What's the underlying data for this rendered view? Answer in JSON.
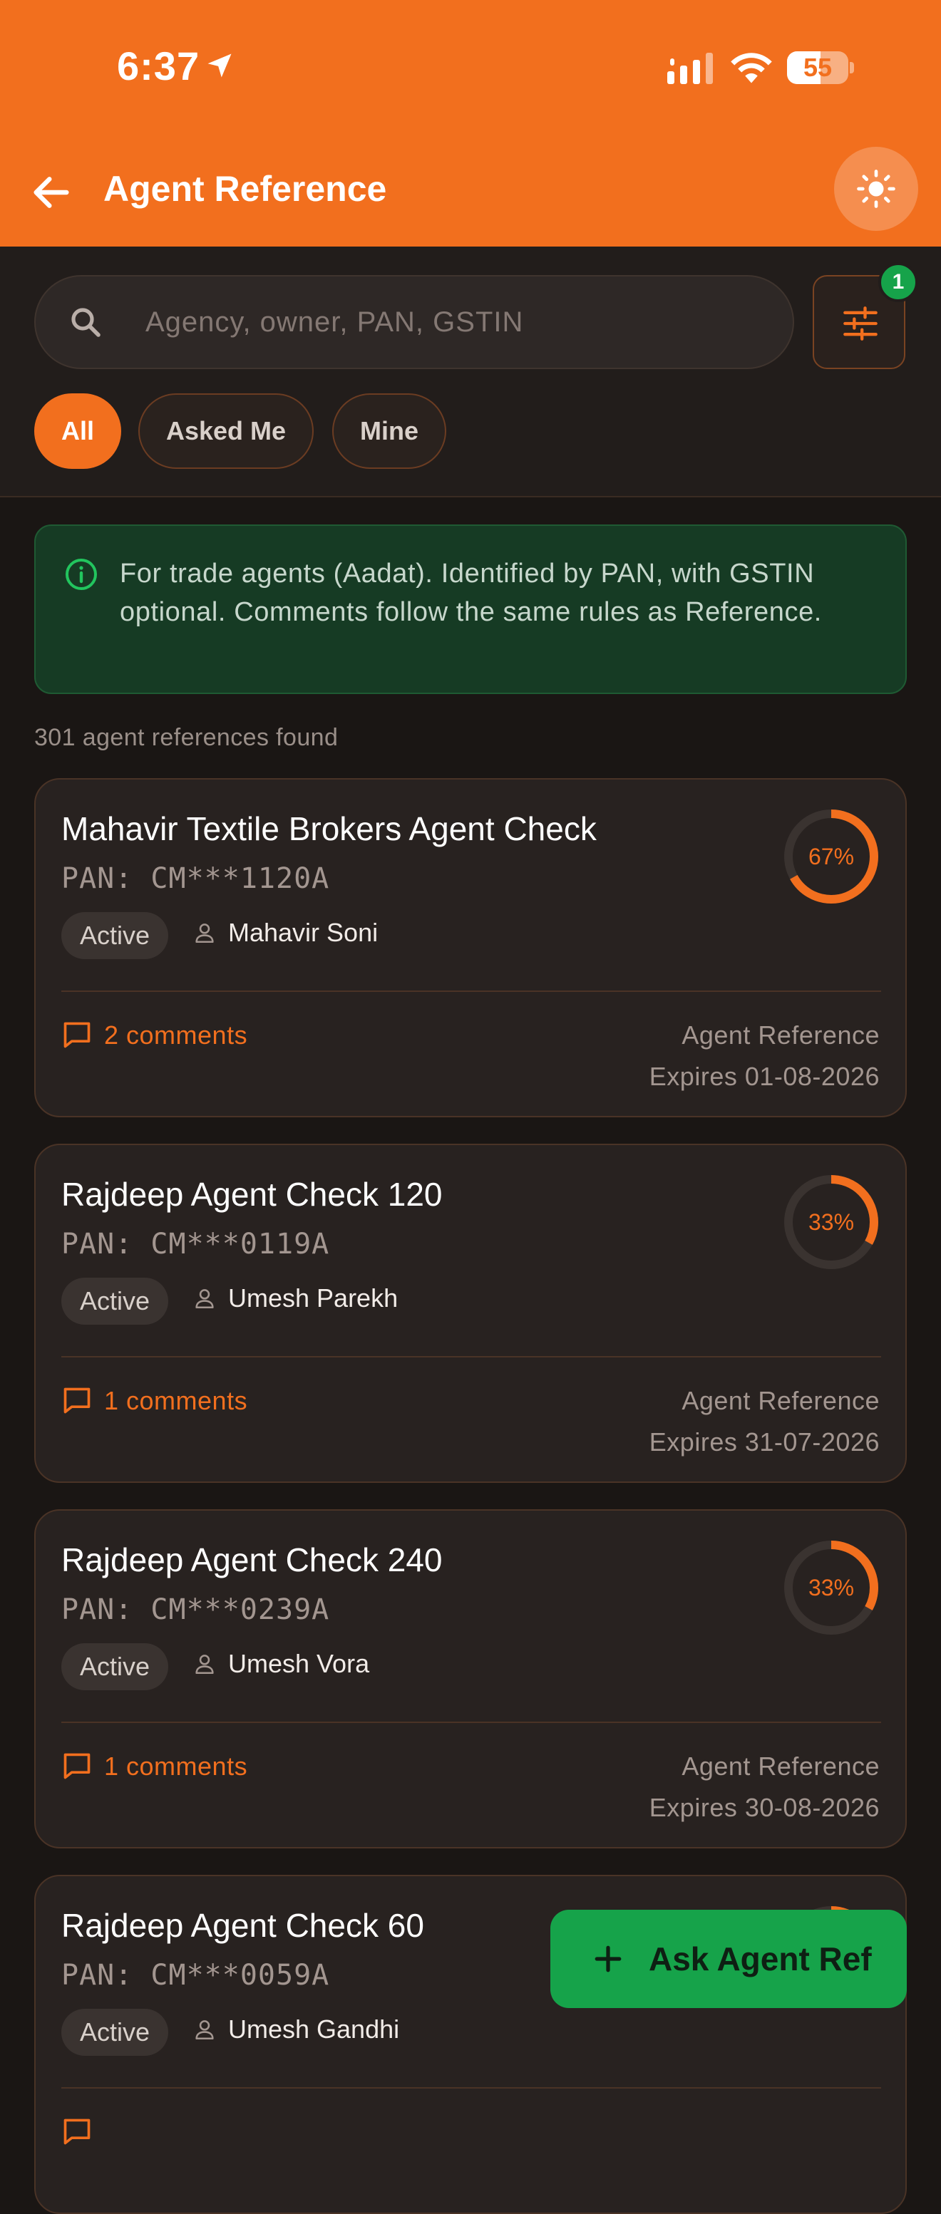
{
  "status_bar": {
    "time": "6:37",
    "battery": "55",
    "battery_level": 0.55
  },
  "header": {
    "title": "Agent Reference"
  },
  "search": {
    "placeholder": "Agency, owner, PAN, GSTIN",
    "value": ""
  },
  "filter": {
    "badge_count": "1"
  },
  "chips": [
    {
      "label": "All",
      "active": true
    },
    {
      "label": "Asked Me",
      "active": false
    },
    {
      "label": "Mine",
      "active": false
    }
  ],
  "info_banner": {
    "text": "For trade agents (Aadat). Identified by PAN, with GSTIN optional. Comments follow the same rules as Reference."
  },
  "result_count": "301 agent references found",
  "cards": [
    {
      "title": "Mahavir Textile Brokers Agent Check",
      "pan": "PAN: CM***1120A",
      "status": "Active",
      "owner": "Mahavir Soni",
      "comments": "2 comments",
      "type": "Agent Reference",
      "expiry": "Expires 01-08-2026",
      "score": "67%",
      "score_value": 0.67
    },
    {
      "title": "Rajdeep Agent Check 120",
      "pan": "PAN: CM***0119A",
      "status": "Active",
      "owner": "Umesh Parekh",
      "comments": "1 comments",
      "type": "Agent Reference",
      "expiry": "Expires 31-07-2026",
      "score": "33%",
      "score_value": 0.33
    },
    {
      "title": "Rajdeep Agent Check 240",
      "pan": "PAN: CM***0239A",
      "status": "Active",
      "owner": "Umesh Vora",
      "comments": "1 comments",
      "type": "Agent Reference",
      "expiry": "Expires 30-08-2026",
      "score": "33%",
      "score_value": 0.33
    },
    {
      "title": "Rajdeep Agent Check 60",
      "pan": "PAN: CM***0059A",
      "status": "Active",
      "owner": "Umesh Gandhi",
      "comments": "",
      "type": "",
      "expiry": "",
      "score": "",
      "score_value": 0.33
    }
  ],
  "fab": {
    "label": "Ask Agent Ref"
  },
  "colors": {
    "accent": "#f26f1e",
    "success": "#16a34a",
    "background": "#1a1614",
    "card": "#282220"
  },
  "icons": {
    "location": "location-arrow-icon",
    "signal": "cellular-signal-icon",
    "wifi": "wifi-icon",
    "back": "arrow-left-icon",
    "theme": "sun-icon",
    "search": "search-icon",
    "filter": "sliders-icon",
    "info": "info-circle-icon",
    "owner": "user-icon",
    "comment": "comment-icon",
    "add": "plus-icon"
  }
}
